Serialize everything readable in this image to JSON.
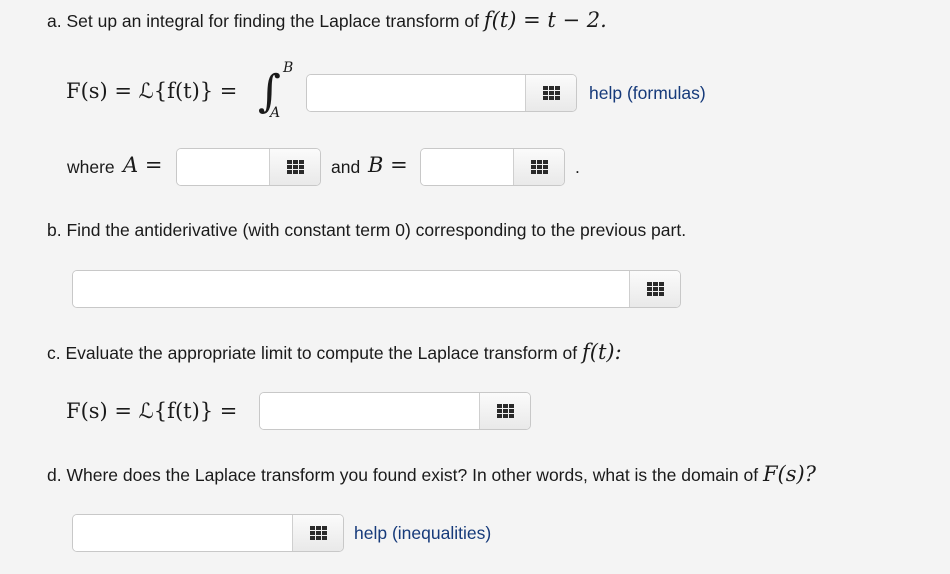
{
  "part_a": {
    "label": "a. Set up an integral for finding the Laplace transform of",
    "function_math": "f(t) = t − 2.",
    "equation_lhs": "F(s) = ℒ{f(t)} =",
    "integral_symbol": "∫",
    "upper_limit": "B",
    "lower_limit": "A",
    "integrand_value": "",
    "help_link": "help (formulas)",
    "where_label": "where",
    "A_math": "A =",
    "A_value": "",
    "and_label": "and",
    "B_math": "B =",
    "B_value": "",
    "period": "."
  },
  "part_b": {
    "label": "b. Find the antiderivative (with constant term 0) corresponding to the previous part.",
    "value": ""
  },
  "part_c": {
    "label": "c. Evaluate the appropriate limit to compute the Laplace transform of",
    "function_math": "f(t):",
    "equation_lhs": "F(s) = ℒ{f(t)} =",
    "value": ""
  },
  "part_d": {
    "label": "d. Where does the Laplace transform you found exist? In other words, what is the domain of",
    "function_math": "F(s)?",
    "value": "",
    "help_link": "help (inequalities)"
  },
  "icons": {
    "keyboard": "grid-keypad-icon"
  },
  "colors": {
    "background": "#f4f4f4",
    "link": "#163a7a",
    "input_border": "#c8c8c8"
  }
}
